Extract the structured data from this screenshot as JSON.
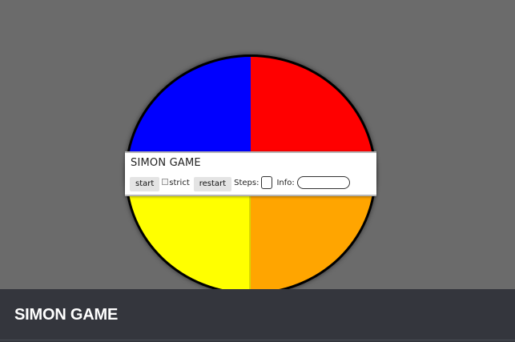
{
  "game": {
    "pads": [
      {
        "name": "blue",
        "color": "#0000ff"
      },
      {
        "name": "red",
        "color": "#ff0000"
      },
      {
        "name": "yellow",
        "color": "#ffff00"
      },
      {
        "name": "orange",
        "color": "#ffa500"
      }
    ],
    "panel": {
      "title": "SIMON GAME",
      "start_label": "start",
      "strict_label": "strict",
      "strict_checked": false,
      "restart_label": "restart",
      "steps_label": "Steps:",
      "steps_value": "",
      "info_label": "Info:",
      "info_value": ""
    }
  },
  "footer": {
    "title": "SIMON GAME"
  },
  "colors": {
    "background": "#6b6b6b",
    "footer_bg": "#34363d"
  }
}
